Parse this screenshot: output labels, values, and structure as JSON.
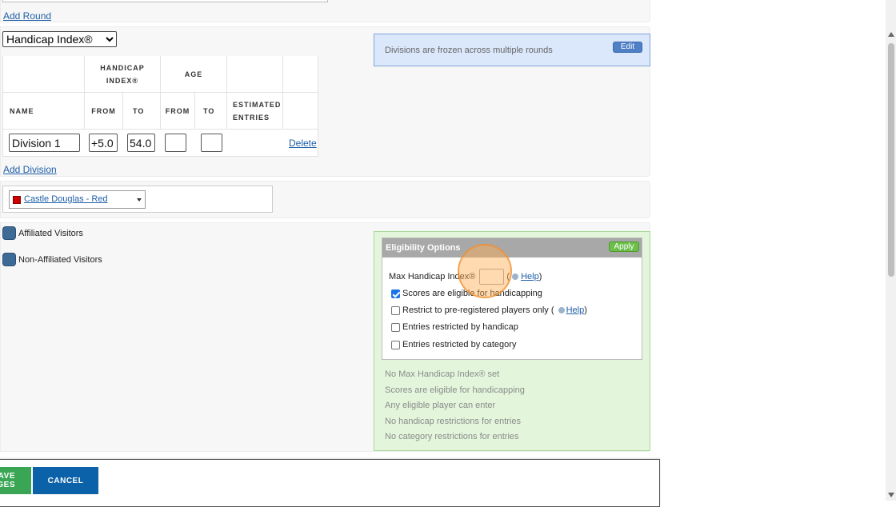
{
  "links": {
    "add_round": "Add Round",
    "add_division": "Add Division"
  },
  "division_method": {
    "selected": "Handicap Index®"
  },
  "frozen_notice": {
    "text": "Divisions are frozen across multiple rounds",
    "edit_label": "Edit"
  },
  "division_table": {
    "group_handicap": "HANDICAP INDEX®",
    "group_age": "AGE",
    "col_name": "NAME",
    "col_from": "FROM",
    "col_to": "TO",
    "col_age_from": "FROM",
    "col_age_to": "TO",
    "col_estimated": "ESTIMATED ENTRIES",
    "row": {
      "name": "Division 1",
      "hcp_from": "+5.0",
      "hcp_to": "54.0",
      "age_from": "",
      "age_to": "",
      "delete_label": "Delete"
    }
  },
  "tee": {
    "label": "Castle Douglas - Red",
    "swatch_color": "#cc0000"
  },
  "visitors": {
    "affiliated": "Affiliated Visitors",
    "non_affiliated": "Non-Affiliated Visitors"
  },
  "eligibility": {
    "title": "Eligibility Options",
    "apply_label": "Apply",
    "max_hcp_label": "Max Handicap Index®",
    "max_hcp_value": "",
    "help_label": "Help",
    "options": [
      {
        "label": "Scores are eligible for handicapping",
        "checked": true
      },
      {
        "label": "Restrict to pre-registered players only (",
        "checked": false
      },
      {
        "label": "Entries restricted by handicap",
        "checked": false
      },
      {
        "label": "Entries restricted by category",
        "checked": false
      }
    ],
    "summary": [
      "No Max Handicap Index® set",
      "Scores are eligible for handicapping",
      "Any eligible player can enter",
      "No handicap restrictions for entries",
      "No category restrictions for entries"
    ]
  },
  "footer": {
    "save_label": "SAVE CHANGES",
    "cancel_label": "CANCEL"
  },
  "colors": {
    "primary_blue": "#0b62a8",
    "save_green": "#3aa655",
    "notice_bg": "#dbe7fb",
    "elig_bg": "#e3f6dc"
  }
}
